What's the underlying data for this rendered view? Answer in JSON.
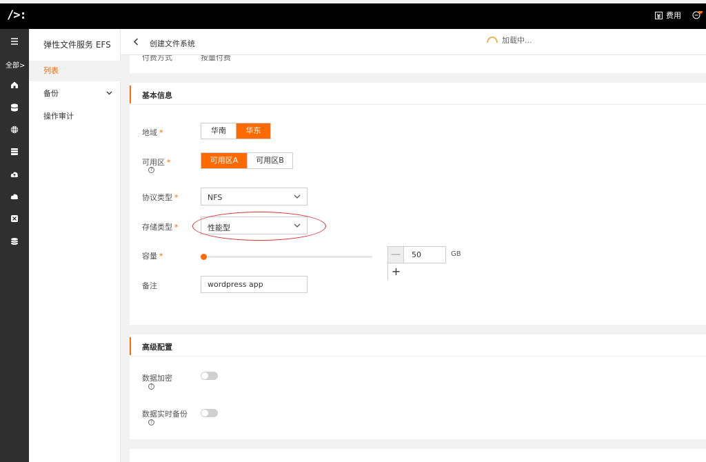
{
  "topbar": {
    "logo": "/>:",
    "billing_label": "费用"
  },
  "sidebar_rail": {
    "all_label": "全部>",
    "icons": [
      "home-icon",
      "database-icon",
      "globe-icon",
      "storage-icon",
      "cloud-upload-icon",
      "cloud-icon",
      "close-box-icon",
      "layers-icon"
    ]
  },
  "subnav": {
    "title": "弹性文件服务 EFS",
    "items": [
      {
        "label": "列表",
        "active": true
      },
      {
        "label": "备份",
        "active": false
      },
      {
        "label": "操作审计",
        "active": false
      }
    ]
  },
  "header": {
    "title": "创建文件系统",
    "loading_text": "加载中..."
  },
  "billing_section": {
    "label": "付费方式",
    "value": "按量付费"
  },
  "basic": {
    "title": "基本信息",
    "region": {
      "label": "地域",
      "options": [
        "华南",
        "华东"
      ],
      "selected": "华东"
    },
    "zone": {
      "label": "可用区",
      "options": [
        "可用区A",
        "可用区B"
      ],
      "selected": "可用区A"
    },
    "protocol": {
      "label": "协议类型",
      "value": "NFS"
    },
    "storage": {
      "label": "存储类型",
      "value": "性能型"
    },
    "capacity": {
      "label": "容量",
      "value": "50",
      "unit": "GB",
      "minus": "—",
      "plus": "+"
    },
    "note": {
      "label": "备注",
      "value": "wordpress app"
    },
    "required_mark": "*"
  },
  "advanced": {
    "title": "高级配置",
    "encryption": {
      "label": "数据加密",
      "enabled": false
    },
    "realtime_backup": {
      "label": "数据实时备份",
      "enabled": false
    }
  },
  "colors": {
    "accent": "#ff6a00",
    "topbar": "#000000",
    "rail": "#2f2f2f",
    "highlight_ellipse": "#dd3333"
  }
}
